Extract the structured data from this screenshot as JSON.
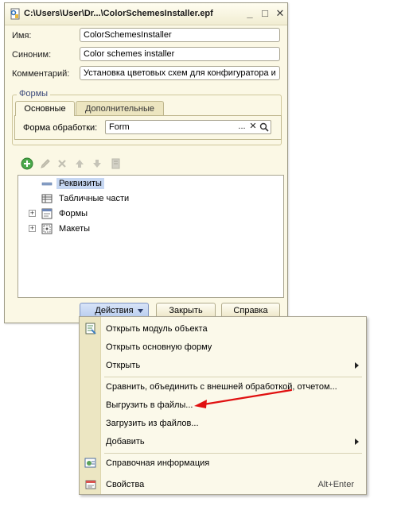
{
  "window": {
    "title": "C:\\Users\\User\\Dr...\\ColorSchemesInstaller.epf",
    "controls": {
      "minimize": "_",
      "maximize": "□",
      "close": "✕"
    }
  },
  "form": {
    "name_label": "Имя:",
    "name_value": "ColorSchemesInstaller",
    "synonym_label": "Синоним:",
    "synonym_value": "Color schemes installer",
    "comment_label": "Комментарий:",
    "comment_value": "Установка цветовых схем для конфигуратора и"
  },
  "forms_group": {
    "title": "Формы",
    "tabs": [
      {
        "label": "Основные",
        "active": true
      },
      {
        "label": "Дополнительные",
        "active": false
      }
    ],
    "processing_form_label": "Форма обработки:",
    "processing_form_value": "Form",
    "select_button": "...",
    "clear_button": "✕"
  },
  "toolbar": {
    "icons": [
      "add-icon",
      "edit-icon",
      "delete-icon",
      "move-up-icon",
      "move-down-icon",
      "sort-icon"
    ]
  },
  "tree": {
    "items": [
      {
        "label": "Реквизиты",
        "icon": "attributes-icon",
        "expandable": false,
        "selected": true
      },
      {
        "label": "Табличные части",
        "icon": "table-icon",
        "expandable": false
      },
      {
        "label": "Формы",
        "icon": "form-icon",
        "expandable": true
      },
      {
        "label": "Макеты",
        "icon": "template-icon",
        "expandable": true
      }
    ]
  },
  "buttons": {
    "actions": "Действия",
    "close": "Закрыть",
    "help": "Справка"
  },
  "menu": {
    "items": [
      {
        "label": "Открыть модуль объекта",
        "icon": "module-icon"
      },
      {
        "label": "Открыть основную форму"
      },
      {
        "label": "Открыть",
        "submenu": true
      },
      {
        "label": "Сравнить, объединить с внешней обработкой, отчетом..."
      },
      {
        "label": "Выгрузить в файлы..."
      },
      {
        "label": "Загрузить из файлов..."
      },
      {
        "label": "Добавить",
        "submenu": true
      },
      {
        "label": "Справочная информация",
        "icon": "reference-info-icon"
      },
      {
        "label": "Свойства",
        "icon": "properties-icon",
        "shortcut": "Alt+Enter"
      }
    ]
  },
  "colors": {
    "window_bg": "#fbf8e5",
    "group_title": "#3c4a7a",
    "selection": "#c6d7f2",
    "annotation_arrow": "#e01010"
  }
}
